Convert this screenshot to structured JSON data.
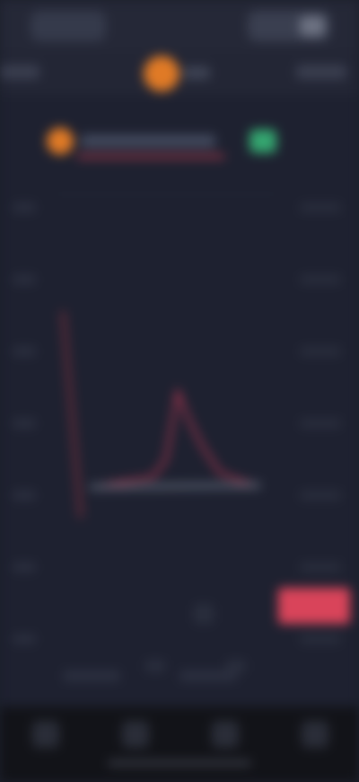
{
  "header": {
    "left_pill": "",
    "right_pill": ""
  },
  "tabs": {
    "left_tab": "",
    "right_tab": "",
    "asset_label": ""
  },
  "chart_area": {
    "legend_text": "",
    "price_tag": ""
  },
  "colors": {
    "background": "#1c1f2b",
    "accent_orange": "#e07a26",
    "accent_red": "#d9445a",
    "accent_green": "#34a56f"
  }
}
